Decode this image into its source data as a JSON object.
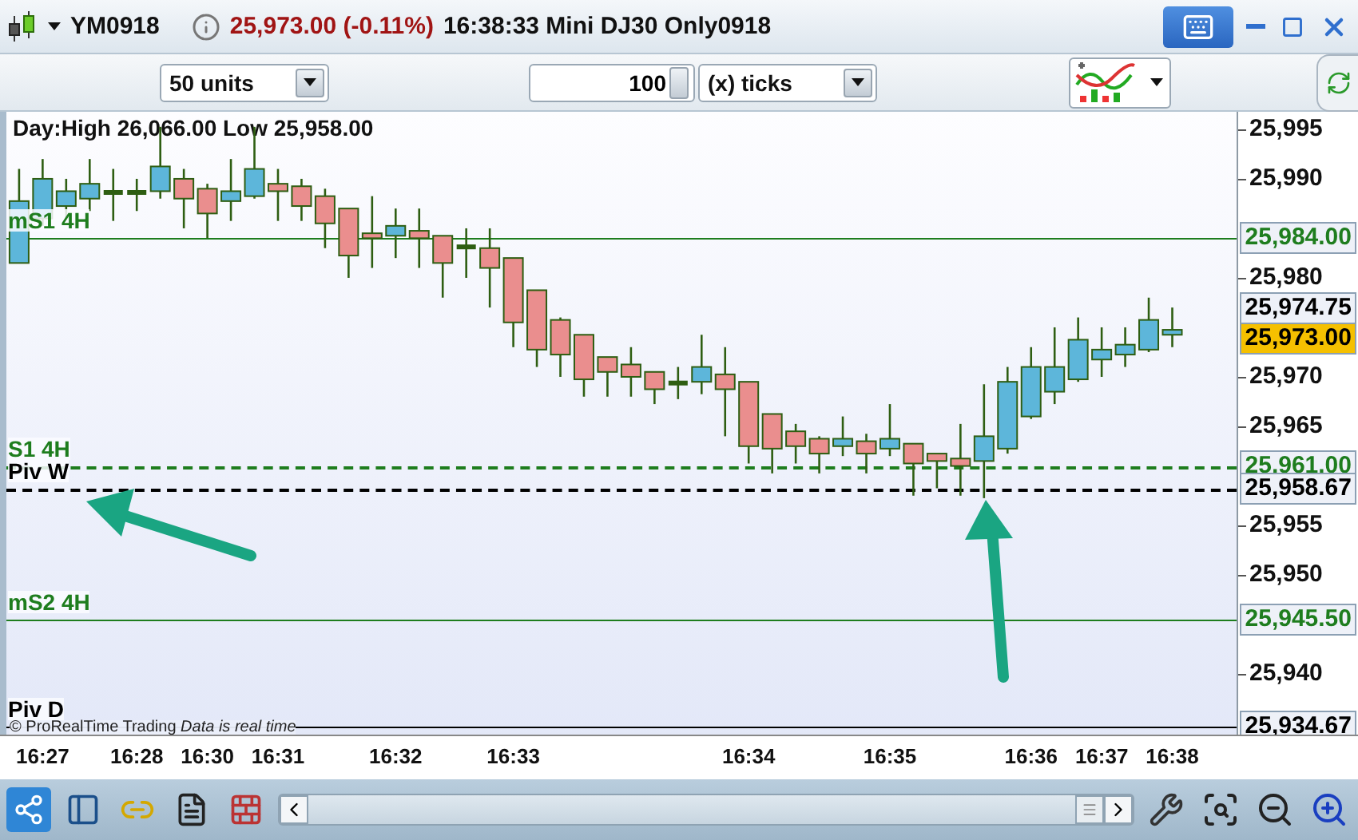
{
  "title_bar": {
    "symbol": "YM0918",
    "quote": "25,973.00 (-0.11%)",
    "description": "16:38:33 Mini DJ30 Only0918"
  },
  "toolbar": {
    "units": "50 units",
    "ticks_value": "100",
    "ticks_unit": "(x) ticks"
  },
  "chart": {
    "header": "Day:High 26,066.00 Low 25,958.00",
    "footer": "© ProRealTime Trading",
    "footer_note": "Data is real time",
    "levels": [
      {
        "price": "25,984.00",
        "dashed": false
      },
      {
        "price": "25,961.00",
        "dashed": true
      },
      {
        "price": "25,958.67",
        "dashed": true
      },
      {
        "price": "25,945.50",
        "dashed": false
      },
      {
        "price": "25,934.67",
        "dashed": false
      }
    ],
    "quotes": [
      {
        "kind": "ask",
        "price": "25,974.75"
      },
      {
        "kind": "last",
        "price": "25,973.00"
      }
    ],
    "chart_data": {
      "type": "candlestick",
      "categories": [
        null,
        "16:27",
        null,
        null,
        null,
        "16:28",
        null,
        null,
        "16:30",
        null,
        null,
        "16:31",
        null,
        null,
        null,
        null,
        "16:32",
        null,
        null,
        null,
        null,
        "16:33",
        null,
        null,
        null,
        null,
        null,
        null,
        null,
        null,
        null,
        "16:34",
        null,
        null,
        null,
        null,
        null,
        "16:35",
        null,
        null,
        null,
        null,
        null,
        "16:36",
        null,
        null,
        "16:37",
        null,
        null,
        "16:38"
      ],
      "ohlc": [
        [
          25981.5,
          25991,
          25981.5,
          25987.75
        ],
        [
          25986,
          25992,
          25985.25,
          25990
        ],
        [
          25987.25,
          25990,
          25986,
          25988.75
        ],
        [
          25988,
          25992,
          25986.75,
          25989.5
        ],
        [
          25988.75,
          25991,
          25985.75,
          25988.5
        ],
        [
          25988.75,
          25990,
          25986.75,
          25988.5
        ],
        [
          25988.75,
          25995.25,
          25988,
          25991.25
        ],
        [
          25990,
          25991,
          25985,
          25988
        ],
        [
          25989,
          25989.5,
          25984,
          25986.5
        ],
        [
          25987.75,
          25992,
          25985.75,
          25988.75
        ],
        [
          25988.25,
          25995.25,
          25988,
          25991
        ],
        [
          25989.5,
          25991,
          25985.75,
          25988.75
        ],
        [
          25989.25,
          25990,
          25985.75,
          25987.25
        ],
        [
          25988.25,
          25989,
          25983,
          25985.5
        ],
        [
          25987,
          25987,
          25980,
          25982.25
        ],
        [
          25984.5,
          25988.25,
          25981,
          25984
        ],
        [
          25984.25,
          25987,
          25982,
          25985.25
        ],
        [
          25984.75,
          25987,
          25981,
          25984
        ],
        [
          25984.25,
          25984.25,
          25978,
          25981.5
        ],
        [
          25983.25,
          25985,
          25980,
          25983
        ],
        [
          25983,
          25985,
          25977,
          25981
        ],
        [
          25982,
          25982,
          25973,
          25975.5
        ],
        [
          25978.75,
          25978.75,
          25971,
          25972.75
        ],
        [
          25975.75,
          25976,
          25970,
          25972.25
        ],
        [
          25974.25,
          25974.25,
          25968,
          25969.75
        ],
        [
          25972,
          25972,
          25968,
          25970.5
        ],
        [
          25971.25,
          25973,
          25968,
          25970
        ],
        [
          25970.5,
          25970.5,
          25967.25,
          25968.75
        ],
        [
          25969.5,
          25971,
          25967.75,
          25969.25
        ],
        [
          25969.5,
          25974.25,
          25968.25,
          25971
        ],
        [
          25970.25,
          25973,
          25964,
          25968.75
        ],
        [
          25969.5,
          25969.5,
          25961.25,
          25963
        ],
        [
          25966.25,
          25966.25,
          25960.25,
          25962.75
        ],
        [
          25964.5,
          25965.25,
          25961.25,
          25963
        ],
        [
          25963.75,
          25964,
          25960.25,
          25962.25
        ],
        [
          25963,
          25966,
          25962,
          25963.75
        ],
        [
          25963.5,
          25964.25,
          25960.25,
          25962.25
        ],
        [
          25962.75,
          25967.25,
          25962,
          25963.75
        ],
        [
          25963.25,
          25963.25,
          25958,
          25961.25
        ],
        [
          25962.25,
          25962.25,
          25958.75,
          25961.5
        ],
        [
          25961.75,
          25965.25,
          25958,
          25961
        ],
        [
          25961.5,
          25969.25,
          25957.75,
          25964
        ],
        [
          25962.75,
          25971,
          25962.25,
          25969.5
        ],
        [
          25966,
          25973,
          25965.75,
          25971
        ],
        [
          25968.5,
          25975,
          25967.25,
          25971
        ],
        [
          25969.75,
          25976,
          25969.5,
          25973.75
        ],
        [
          25971.75,
          25975,
          25970,
          25972.75
        ],
        [
          25972.25,
          25975,
          25971,
          25973.25
        ],
        [
          25972.75,
          25978,
          25972.5,
          25975.75
        ],
        [
          25974.25,
          25977,
          25973,
          25974.75
        ]
      ],
      "ylim": [
        25933.87,
        25996.77
      ],
      "ref_lines": [
        {
          "axis": "y",
          "value": 25984,
          "label": "mS1 4H",
          "color": "#1e7d1e"
        },
        {
          "axis": "y",
          "value": 25961,
          "label": "S1 4H",
          "color": "#1e7d1e"
        },
        {
          "axis": "y",
          "value": 25958.67,
          "label": "Piv W",
          "color": "#000000"
        },
        {
          "axis": "y",
          "value": 25945.5,
          "label": "mS2 4H",
          "color": "#1e7d1e"
        },
        {
          "axis": "y",
          "value": 25934.67,
          "label": "Piv D",
          "color": "#000000"
        }
      ],
      "yticks": [
        {
          "value": 25995,
          "label": "25,995"
        },
        {
          "value": 25990,
          "label": "25,990"
        },
        {
          "value": 25980,
          "label": "25,980"
        },
        {
          "value": 25970,
          "label": "25,970"
        },
        {
          "value": 25965,
          "label": "25,965"
        },
        {
          "value": 25955,
          "label": "25,955"
        },
        {
          "value": 25950,
          "label": "25,950"
        },
        {
          "value": 25940,
          "label": "25,940"
        }
      ]
    }
  }
}
